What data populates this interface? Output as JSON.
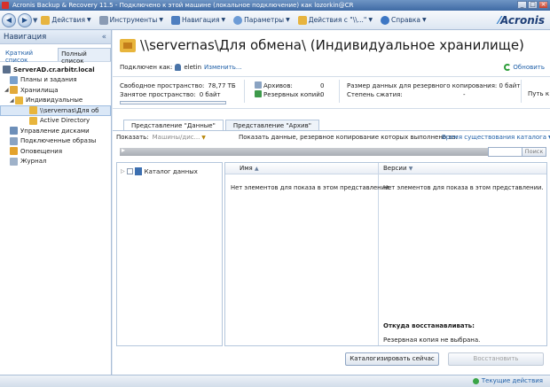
{
  "window": {
    "title": "Acronis Backup & Recovery 11.5 - Подключено к этой машине (локальное подключение) как lozorkin@CR",
    "buttons": {
      "minimize": "_",
      "maximize": "□",
      "close": "×"
    }
  },
  "toolbar": {
    "back": "◀",
    "forward": "▶",
    "items": [
      "Действия",
      "Инструменты",
      "Навигация",
      "Параметры",
      "Действия с \"\\\\...\"",
      "Справка"
    ],
    "logo": "Acronis"
  },
  "sidebar": {
    "title": "Навигация",
    "collapse": "«",
    "tabs": [
      "Краткий список",
      "Полный список"
    ],
    "tree": [
      {
        "label": "ServerAD.cr.arbitr.local",
        "level": 0,
        "bold": true,
        "icon": "computer-icon"
      },
      {
        "label": "Планы и задания",
        "level": 1,
        "icon": "plans-icon"
      },
      {
        "label": "Хранилища",
        "level": 1,
        "icon": "vaults-icon"
      },
      {
        "label": "Индивидуальные",
        "level": 2,
        "icon": "folder-icon"
      },
      {
        "label": "\\\\servernas\\Для об",
        "level": 3,
        "icon": "folder-icon",
        "selected": true
      },
      {
        "label": "Active Directory",
        "level": 3,
        "icon": "folder-icon"
      },
      {
        "label": "Управление дисками",
        "level": 1,
        "icon": "disk-icon"
      },
      {
        "label": "Подключенные образы",
        "level": 1,
        "icon": "image-icon"
      },
      {
        "label": "Оповещения",
        "level": 1,
        "icon": "alert-icon"
      },
      {
        "label": "Журнал",
        "level": 1,
        "icon": "log-icon"
      }
    ]
  },
  "main": {
    "title": "\\\\servernas\\Для обмена\\ (Индивидуальное хранилище)",
    "connected_as_label": "Подключен как:",
    "user": "eletin",
    "change_link": "Изменить...",
    "refresh": "Обновить",
    "stats": {
      "free_label": "Свободное пространство:",
      "free_value": "78,77 ТБ",
      "used_label": "Занятое пространство:",
      "used_value": "0 байт",
      "used_fraction": 0,
      "archives_label": "Архивов:",
      "archives_value": "0",
      "backups_label": "Резервных копий:",
      "backups_value": "0",
      "data_size_label": "Размер данных для резервного копирования: 0 байт",
      "compression_label": "Степень сжатия:",
      "compression_value": "-",
      "path_label": "Путь к"
    },
    "tabs": [
      "Представление \"Данные\"",
      "Представление \"Архив\""
    ],
    "filter": {
      "show_label": "Показать:",
      "show_value": "Машины/дис...",
      "backed_up_label": "Показать данные, резервное копирование которых выполнено за:",
      "period_link": "Время существования каталога"
    },
    "search_button": "Поиск",
    "catalog_root": "Каталог данных",
    "columns": {
      "name": "Имя",
      "versions": "Версии"
    },
    "empty_message": "Нет элементов для показа в этом представлении.",
    "restore_from_label": "Откуда восстанавливать:",
    "restore_from_value": "Резервная копия не выбрана.",
    "buttons": {
      "catalog_now": "Каталогизировать сейчас",
      "restore": "Восстановить"
    }
  },
  "statusbar": {
    "current_actions": "Текущие действия"
  }
}
